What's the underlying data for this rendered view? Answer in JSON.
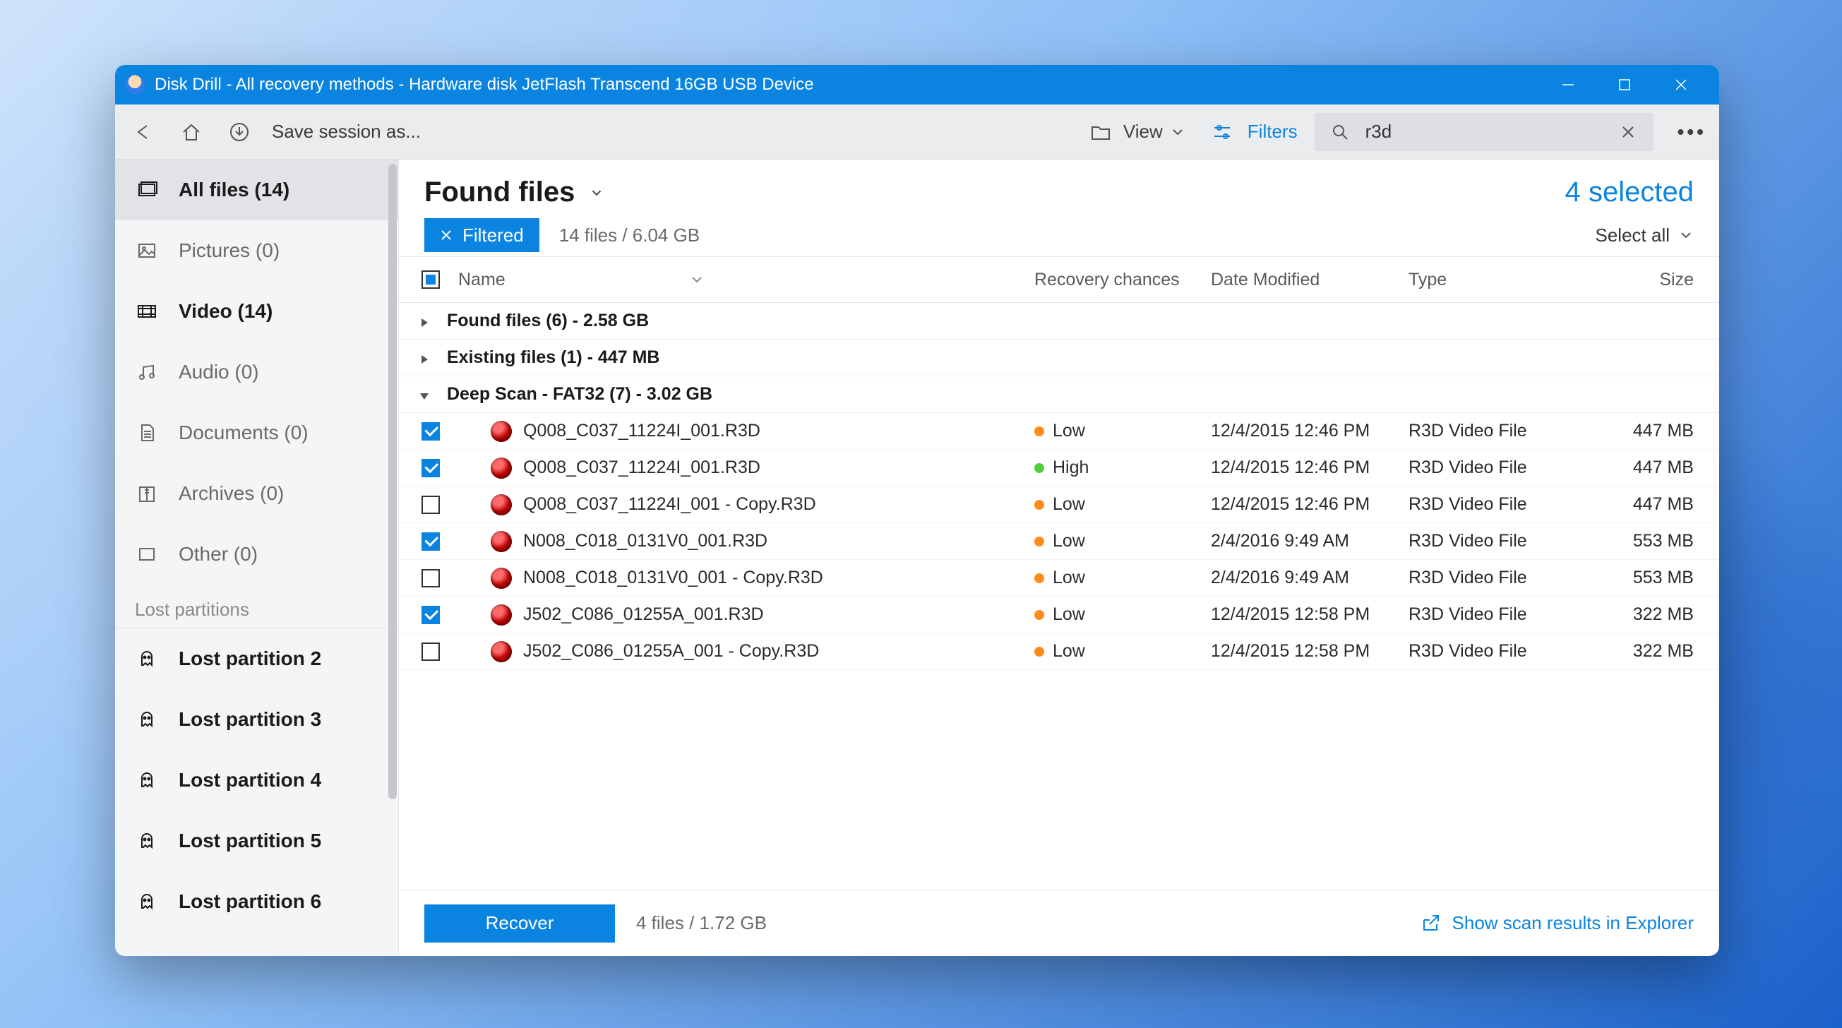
{
  "window": {
    "title": "Disk Drill - All recovery methods - Hardware disk JetFlash Transcend 16GB USB Device"
  },
  "toolbar": {
    "save_session": "Save session as...",
    "view_label": "View",
    "filters_label": "Filters",
    "search_value": "r3d"
  },
  "sidebar": {
    "items": [
      {
        "label": "All files (14)"
      },
      {
        "label": "Pictures (0)"
      },
      {
        "label": "Video (14)"
      },
      {
        "label": "Audio (0)"
      },
      {
        "label": "Documents (0)"
      },
      {
        "label": "Archives (0)"
      },
      {
        "label": "Other (0)"
      }
    ],
    "section_header": "Lost partitions",
    "partitions": [
      {
        "label": "Lost partition 2"
      },
      {
        "label": "Lost partition 3"
      },
      {
        "label": "Lost partition 4"
      },
      {
        "label": "Lost partition 5"
      },
      {
        "label": "Lost partition 6"
      }
    ]
  },
  "main": {
    "title": "Found files",
    "selected": "4 selected",
    "filtered_chip": "Filtered",
    "count_summary": "14 files / 6.04 GB",
    "select_all": "Select all",
    "columns": {
      "name": "Name",
      "chance": "Recovery chances",
      "date": "Date Modified",
      "type": "Type",
      "size": "Size"
    },
    "groups": [
      {
        "label": "Found files (6) - 2.58 GB",
        "expanded": false
      },
      {
        "label": "Existing files (1) - 447 MB",
        "expanded": false
      },
      {
        "label": "Deep Scan - FAT32 (7) - 3.02 GB",
        "expanded": true
      }
    ],
    "rows": [
      {
        "checked": true,
        "name": "Q008_C037_11224I_001.R3D",
        "chance": "Low",
        "dot": "low",
        "date": "12/4/2015 12:46 PM",
        "type": "R3D Video File",
        "size": "447 MB"
      },
      {
        "checked": true,
        "name": "Q008_C037_11224I_001.R3D",
        "chance": "High",
        "dot": "high",
        "date": "12/4/2015 12:46 PM",
        "type": "R3D Video File",
        "size": "447 MB"
      },
      {
        "checked": false,
        "name": "Q008_C037_11224I_001 - Copy.R3D",
        "chance": "Low",
        "dot": "low",
        "date": "12/4/2015 12:46 PM",
        "type": "R3D Video File",
        "size": "447 MB"
      },
      {
        "checked": true,
        "name": "N008_C018_0131V0_001.R3D",
        "chance": "Low",
        "dot": "low",
        "date": "2/4/2016 9:49 AM",
        "type": "R3D Video File",
        "size": "553 MB"
      },
      {
        "checked": false,
        "name": "N008_C018_0131V0_001 - Copy.R3D",
        "chance": "Low",
        "dot": "low",
        "date": "2/4/2016 9:49 AM",
        "type": "R3D Video File",
        "size": "553 MB"
      },
      {
        "checked": true,
        "name": "J502_C086_01255A_001.R3D",
        "chance": "Low",
        "dot": "low",
        "date": "12/4/2015 12:58 PM",
        "type": "R3D Video File",
        "size": "322 MB"
      },
      {
        "checked": false,
        "name": "J502_C086_01255A_001 - Copy.R3D",
        "chance": "Low",
        "dot": "low",
        "date": "12/4/2015 12:58 PM",
        "type": "R3D Video File",
        "size": "322 MB"
      }
    ]
  },
  "footer": {
    "recover": "Recover",
    "count": "4 files / 1.72 GB",
    "explorer": "Show scan results in Explorer"
  }
}
